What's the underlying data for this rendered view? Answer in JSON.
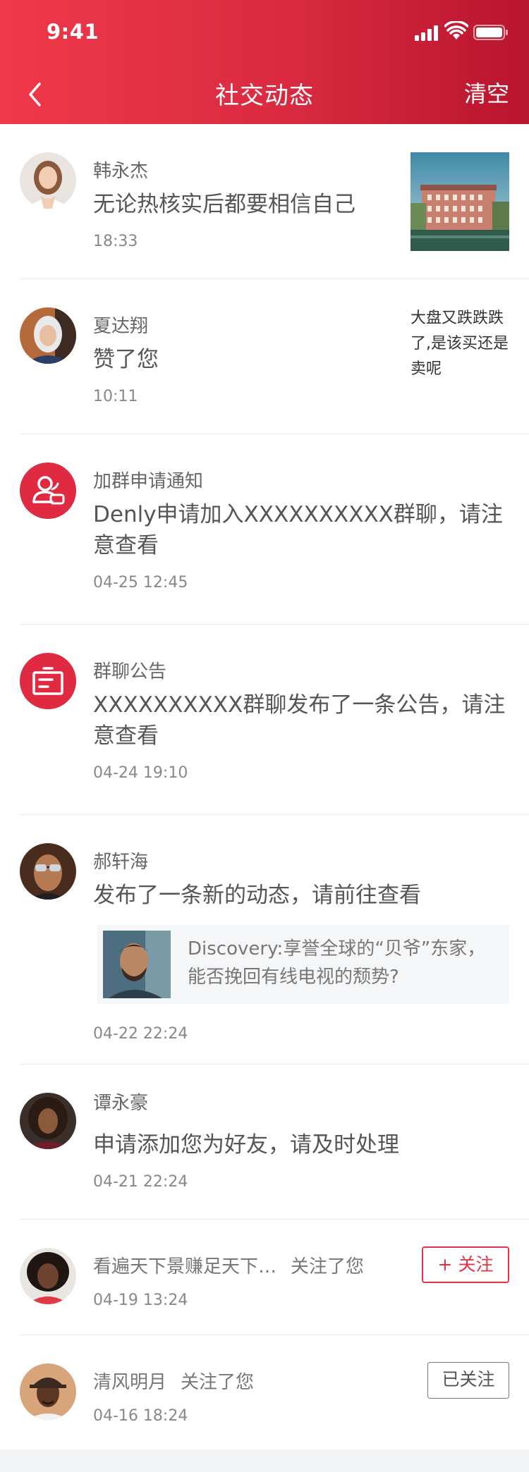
{
  "status": {
    "time": "9:41"
  },
  "header": {
    "title": "社交动态",
    "clear_label": "清空"
  },
  "colors": {
    "brand_red": "#e02a41",
    "header_left": "#f0394a",
    "header_right": "#b8152e"
  },
  "items": [
    {
      "type": "comment",
      "name": "韩永杰",
      "message": "无论热核实后都要相信自己",
      "time": "18:33",
      "avatar_icon": "avatar-photo",
      "thumb_icon": "hotel-photo"
    },
    {
      "type": "like",
      "name": "夏达翔",
      "message": "赞了您",
      "time": "10:11",
      "avatar_icon": "avatar-photo",
      "side_text": "大盘又跌跌跌了,是该买还是卖呢"
    },
    {
      "type": "group-join",
      "name": "加群申请通知",
      "message": "Denly申请加入XXXXXXXXXX群聊，请注意查看",
      "time": "04-25 12:45",
      "avatar_icon": "user-add-icon"
    },
    {
      "type": "announcement",
      "name": "群聊公告",
      "message": "XXXXXXXXXX群聊发布了一条公告，请注意查看",
      "time": "04-24 19:10",
      "avatar_icon": "announcement-icon"
    },
    {
      "type": "post",
      "name": "郝轩海",
      "message": "发布了一条新的动态，请前往查看",
      "time": "04-22 22:24",
      "avatar_icon": "avatar-photo",
      "card_text": "Discovery:享誉全球的“贝爷”东家，能否挽回有线电视的颓势?"
    },
    {
      "type": "friend-request",
      "name": "谭永豪",
      "message": "申请添加您为好友，请及时处理",
      "time": "04-21 22:24",
      "avatar_icon": "avatar-photo"
    },
    {
      "type": "follow",
      "name": "看遍天下景赚足天下…",
      "action": "关注了您",
      "time": "04-19 13:24",
      "avatar_icon": "avatar-photo",
      "button": "+ 关注"
    },
    {
      "type": "follow",
      "name": "清风明月",
      "action": "关注了您",
      "time": "04-16 18:24",
      "avatar_icon": "avatar-photo",
      "button": "已关注"
    }
  ]
}
